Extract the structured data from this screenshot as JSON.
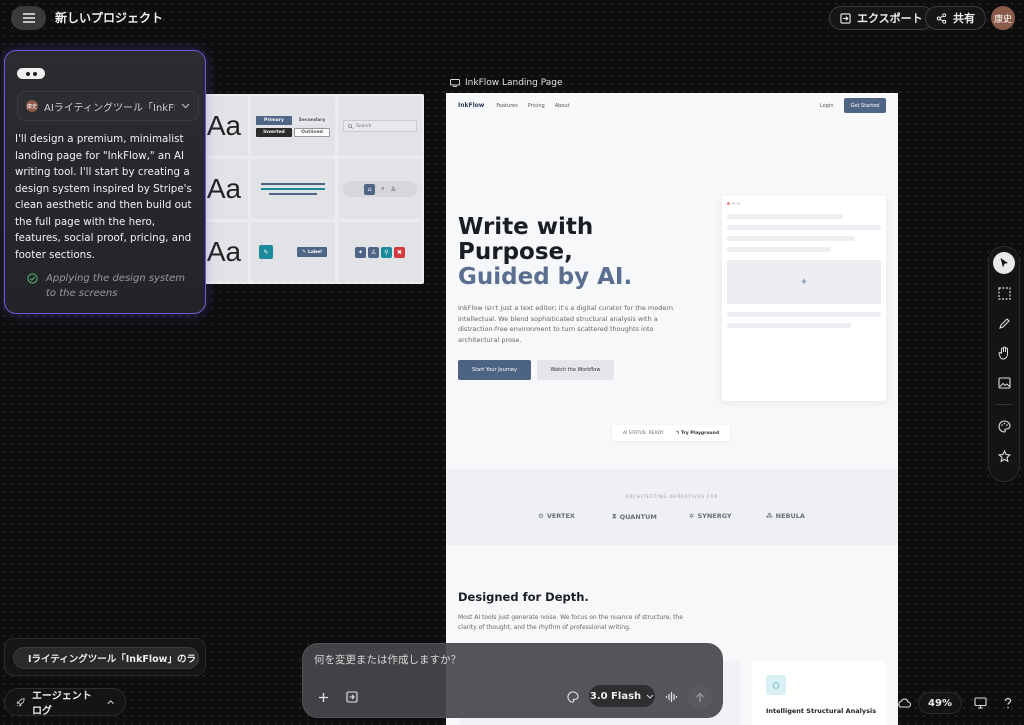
{
  "header": {
    "project_title": "新しいプロジェクト",
    "export_label": "エクスポート",
    "share_label": "共有",
    "avatar_text": "康史"
  },
  "chat": {
    "select_label": "AIライティングツール「InkFlo…",
    "avatar_text": "康史",
    "message": "I'll design a premium, minimalist landing page for \"InkFlow,\" an AI writing tool. I'll start by creating a design system inspired by Stripe's clean aesthetic and then build out the full page with the hero, features, social proof, pricing, and footer sections.",
    "status": "Applying the design system to the screens"
  },
  "design_system": {
    "aa": "Aa",
    "primary": "Primary",
    "secondary": "Secondary",
    "inverted": "Inverted",
    "outlined": "Outlined",
    "search_placeholder": "Search",
    "label": "Label"
  },
  "frame": {
    "label": "InkFlow Landing Page"
  },
  "landing": {
    "logo": "InkFlow",
    "nav": [
      "Features",
      "Pricing",
      "About"
    ],
    "login": "Login",
    "get_started": "Get Started",
    "hero_line1": "Write with",
    "hero_line2": "Purpose,",
    "hero_line3": "Guided by AI.",
    "hero_desc": "InkFlow isn't just a text editor; it's a digital curator for the modern intellectual. We blend sophisticated structural analysis with a distraction-free environment to turn scattered thoughts into architectural prose.",
    "cta_primary": "Start Your Journey",
    "cta_secondary": "Watch the Workflow",
    "status_text": "AI STATUS: READY",
    "try_playground": "Try Playground",
    "logos_heading": "ARCHITECTING NARRATIVES FOR",
    "logos": [
      "VERTEX",
      "QUANTUM",
      "SYNERGY",
      "NEBULA"
    ],
    "depth_title": "Designed for Depth.",
    "depth_desc": "Most AI tools just generate noise. We focus on the nuance of structure, the clarity of thought, and the rhythm of professional writing.",
    "feature_title": "Intelligent Structural Analysis"
  },
  "prompt": {
    "placeholder": "何を変更または作成しますか？",
    "model": "3.0 Flash"
  },
  "task": {
    "label": "Iライティングツール「InkFlow」のランデ…"
  },
  "agent_log": {
    "label": "エージェント ログ"
  },
  "zoom": {
    "level": "49%"
  },
  "colors": {
    "accent_purple": "#6a5ad8",
    "landing_primary": "#4f6585",
    "teal": "#1a8a9c",
    "red": "#d23c3c"
  }
}
